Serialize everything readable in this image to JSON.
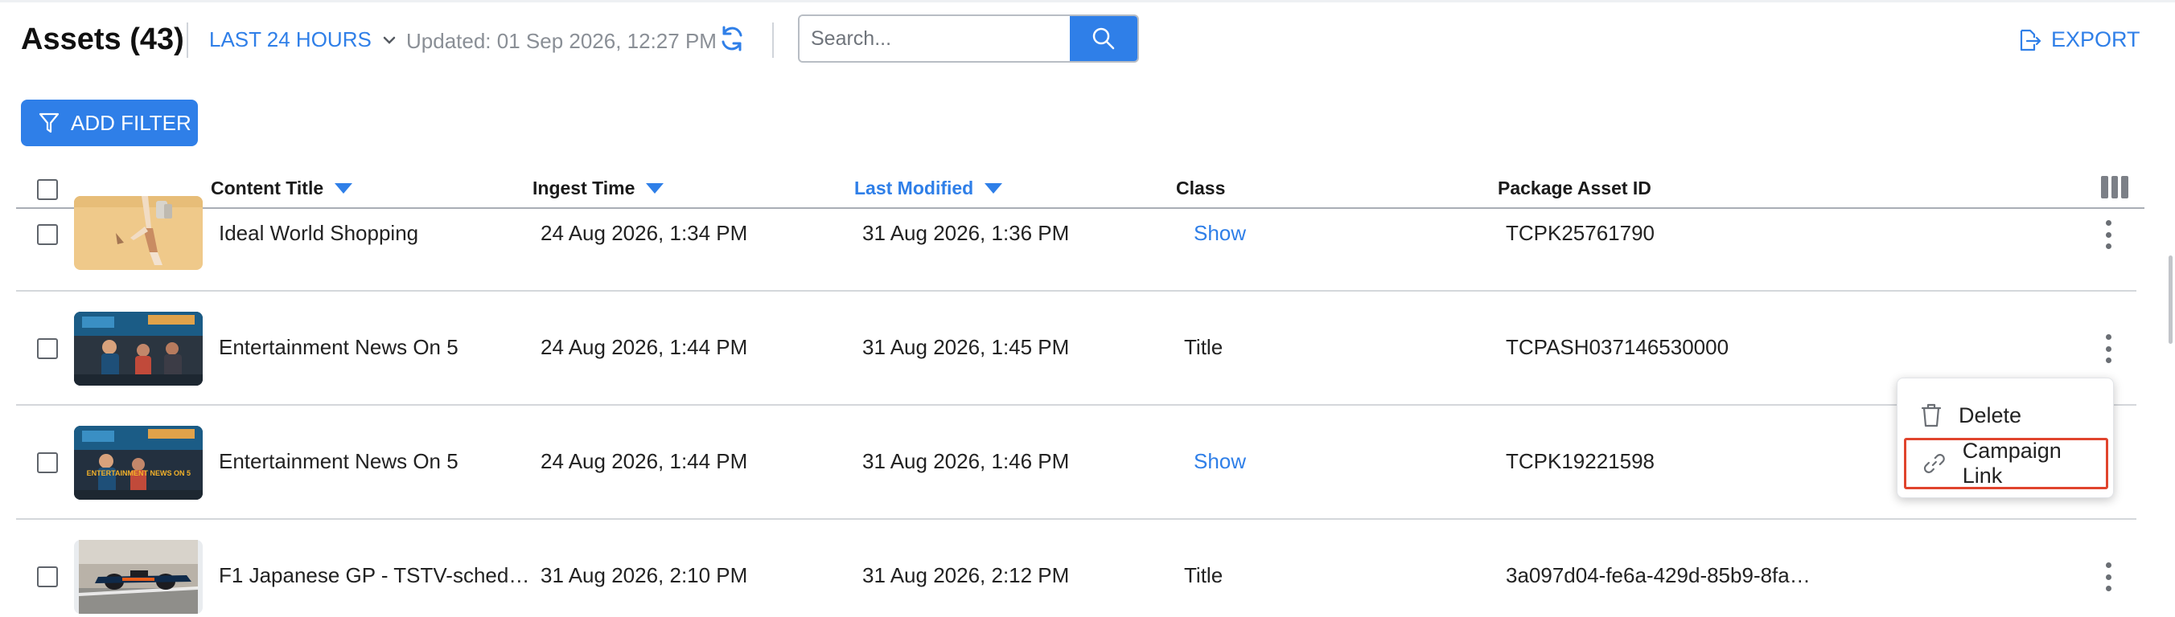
{
  "header": {
    "title": "Assets (43)",
    "time_range": "LAST 24 HOURS",
    "updated": "Updated: 01 Sep 2026, 12:27 PM",
    "search_placeholder": "Search...",
    "export_label": "EXPORT"
  },
  "filter": {
    "add_label": "ADD FILTER"
  },
  "columns": {
    "content_title": "Content Title",
    "ingest_time": "Ingest Time",
    "last_modified": "Last Modified",
    "class": "Class",
    "package_asset_id": "Package Asset ID"
  },
  "rows": [
    {
      "title": "Ideal World Shopping",
      "ingest": "24 Aug 2026, 1:34 PM",
      "modified": "31 Aug 2026, 1:36 PM",
      "class": "Show",
      "asset_id": "TCPK25761790",
      "class_link": true,
      "thumb": "shopping"
    },
    {
      "title": "Entertainment News On 5",
      "ingest": "24 Aug 2026, 1:44 PM",
      "modified": "31 Aug 2026, 1:45 PM",
      "class": "Title",
      "asset_id": "TCPASH037146530000",
      "class_link": false,
      "thumb": "news"
    },
    {
      "title": "Entertainment News On 5",
      "ingest": "24 Aug 2026, 1:44 PM",
      "modified": "31 Aug 2026, 1:46 PM",
      "class": "Show",
      "asset_id": "TCPK19221598",
      "class_link": true,
      "thumb": "news-logo",
      "thumb_text": "ENTERTAINMENT NEWS ON 5"
    },
    {
      "title": "F1 Japanese GP - TSTV-sched…",
      "ingest": "31 Aug 2026, 2:10 PM",
      "modified": "31 Aug 2026, 2:12 PM",
      "class": "Title",
      "asset_id": "3a097d04-fe6a-429d-85b9-8fa…",
      "class_link": false,
      "thumb": "f1"
    }
  ],
  "context_menu": {
    "items": [
      {
        "label": "Delete",
        "icon": "trash-icon"
      },
      {
        "label": "Campaign Link",
        "icon": "link-icon",
        "highlighted": true
      }
    ]
  },
  "colors": {
    "accent": "#2f7fe8",
    "highlight_border": "#e0442d"
  }
}
